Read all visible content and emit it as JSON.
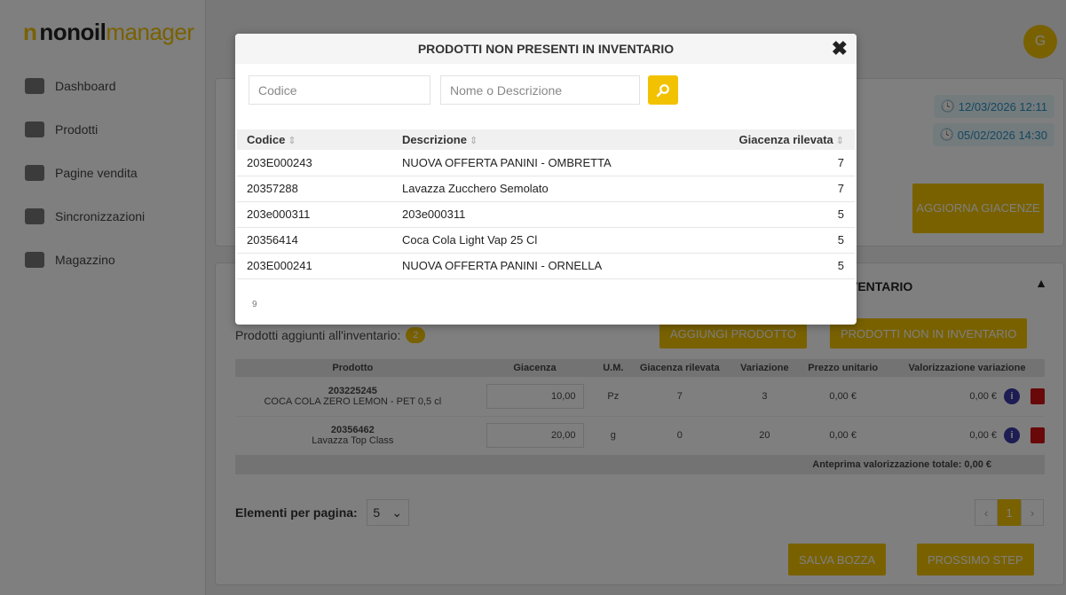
{
  "app": {
    "logo_mark": "n",
    "logo_word1": "nonoil",
    "logo_word2": "manager",
    "avatar_initial": "G"
  },
  "sidebar": {
    "items": [
      {
        "label": "Dashboard",
        "icon": "home-icon"
      },
      {
        "label": "Prodotti",
        "icon": "burger-icon"
      },
      {
        "label": "Pagine vendita",
        "icon": "shop-icon"
      },
      {
        "label": "Sincronizzazioni",
        "icon": "cloud-sync-icon"
      },
      {
        "label": "Magazzino",
        "icon": "warehouse-icon"
      }
    ]
  },
  "header": {
    "dates": [
      "12/03/2026 12:11",
      "05/02/2026 14:30"
    ],
    "aggiorna_label": "AGGIORNA GIACENZE"
  },
  "inventory": {
    "title": "INVENTARIO",
    "added_label": "Prodotti aggiunti all'inventario:",
    "added_count": "2",
    "add_button": "AGGIUNGI PRODOTTO",
    "not_in_inventory_button": "PRODOTTI NON IN INVENTARIO",
    "columns": [
      "Prodotto",
      "Giacenza",
      "U.M.",
      "Giacenza rilevata",
      "Variazione",
      "Prezzo unitario",
      "Valorizzazione variazione"
    ],
    "rows": [
      {
        "code": "203225245",
        "name": "COCA COLA ZERO LEMON - PET 0,5 cl",
        "giacenza": "10,00",
        "um": "Pz",
        "rilevata": "7",
        "variazione": "3",
        "prezzo": "0,00 €",
        "valorizzazione": "0,00 €"
      },
      {
        "code": "20356462",
        "name": "Lavazza Top Class",
        "giacenza": "20,00",
        "um": "g",
        "rilevata": "0",
        "variazione": "20",
        "prezzo": "0,00 €",
        "valorizzazione": "0,00 €"
      }
    ],
    "total_label": "Anteprima valorizzazione totale: 0,00 €",
    "per_page_label": "Elementi per pagina:",
    "per_page_value": "5",
    "current_page": "1",
    "save_draft": "SALVA BOZZA",
    "next_step": "PROSSIMO STEP"
  },
  "modal": {
    "title": "PRODOTTI NON PRESENTI IN INVENTARIO",
    "close_glyph": "✖",
    "codice_placeholder": "Codice",
    "nome_placeholder": "Nome o Descrizione",
    "columns": {
      "codice": "Codice",
      "descrizione": "Descrizione",
      "giacenza": "Giacenza rilevata"
    },
    "rows": [
      {
        "codice": "203E000243",
        "descrizione": "NUOVA OFFERTA PANINI - OMBRETTA",
        "giacenza": "7"
      },
      {
        "codice": "20357288",
        "descrizione": "Lavazza Zucchero Semolato",
        "giacenza": "7"
      },
      {
        "codice": "203e000311",
        "descrizione": "203e000311",
        "giacenza": "5"
      },
      {
        "codice": "20356414",
        "descrizione": "Coca Cola Light Vap 25 Cl",
        "giacenza": "5"
      },
      {
        "codice": "203E000241",
        "descrizione": "NUOVA OFFERTA PANINI - ORNELLA",
        "giacenza": "5"
      }
    ],
    "footer_count": "9"
  },
  "colors": {
    "accent": "#f2c200",
    "danger": "#d01010",
    "info": "#3a3aa8"
  }
}
